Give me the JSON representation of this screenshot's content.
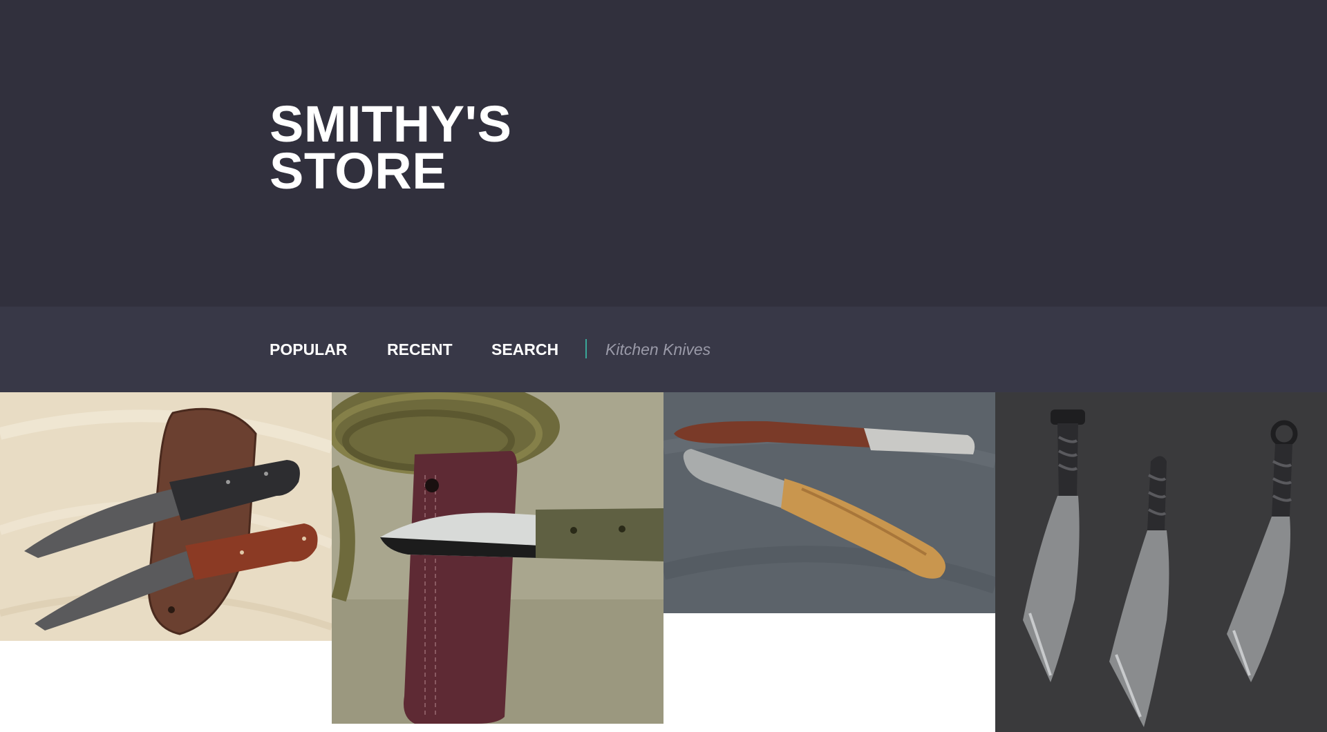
{
  "store": {
    "title_line1": "SMITHY'S",
    "title_line2": "STORE"
  },
  "nav": {
    "items": [
      {
        "label": "POPULAR"
      },
      {
        "label": "RECENT"
      },
      {
        "label": "SEARCH"
      }
    ],
    "search_placeholder": "Kitchen Knives"
  },
  "products": [
    {
      "image": "two hunting knives on leather sheath"
    },
    {
      "image": "bushcraft knife with leather sheath and paracord"
    },
    {
      "image": "two wooden-handled kitchen knives on slate"
    },
    {
      "image": "three forged railroad-spike knives"
    }
  ],
  "colors": {
    "header_bg": "#31303d",
    "nav_bg": "#383847",
    "accent": "#3aa89a"
  }
}
